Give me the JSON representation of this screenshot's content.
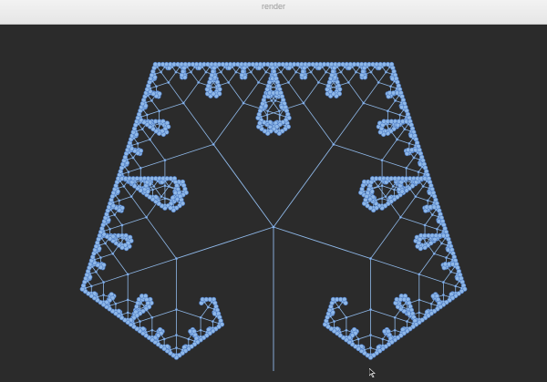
{
  "window": {
    "title": "render"
  },
  "graph": {
    "type": "pentagonal-fractal-tree",
    "depth": 6,
    "branches_per_node": 3,
    "edge_color": "#8fb8e8",
    "node_color": "#8fb8e8",
    "node_outline_color": "#4a78c0",
    "background_color": "#2b2b2b"
  },
  "icons": {
    "cursor": "arrow-cursor-icon"
  }
}
